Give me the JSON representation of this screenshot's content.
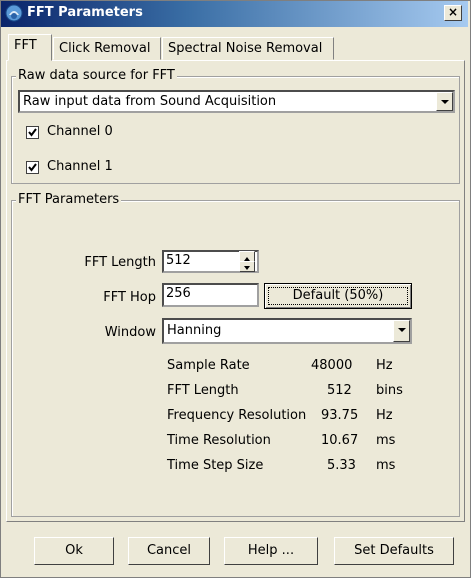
{
  "window": {
    "title": "FFT Parameters",
    "close_label": "×"
  },
  "tabs": [
    "FFT",
    "Click Removal",
    "Spectral Noise Removal"
  ],
  "raw_source": {
    "legend": "Raw data source for FFT",
    "selected": "Raw input data from Sound Acquisition",
    "channels": [
      {
        "label": "Channel 0",
        "checked": true
      },
      {
        "label": "Channel 1",
        "checked": true
      }
    ]
  },
  "fft": {
    "legend": "FFT Parameters",
    "length_label": "FFT Length",
    "length_value": "512",
    "hop_label": "FFT Hop",
    "hop_value": "256",
    "default_button": "Default (50%)",
    "window_label": "Window",
    "window_value": "Hanning",
    "info": [
      {
        "name": "Sample Rate",
        "value": "48000",
        "unit": "Hz"
      },
      {
        "name": "FFT Length",
        "value": "512",
        "unit": "bins"
      },
      {
        "name": "Frequency Resolution",
        "value": "93.75",
        "unit": "Hz"
      },
      {
        "name": "Time Resolution",
        "value": "10.67",
        "unit": "ms"
      },
      {
        "name": "Time Step Size",
        "value": "5.33",
        "unit": "ms"
      }
    ]
  },
  "buttons": {
    "ok": "Ok",
    "cancel": "Cancel",
    "help": "Help ...",
    "defaults": "Set Defaults"
  }
}
